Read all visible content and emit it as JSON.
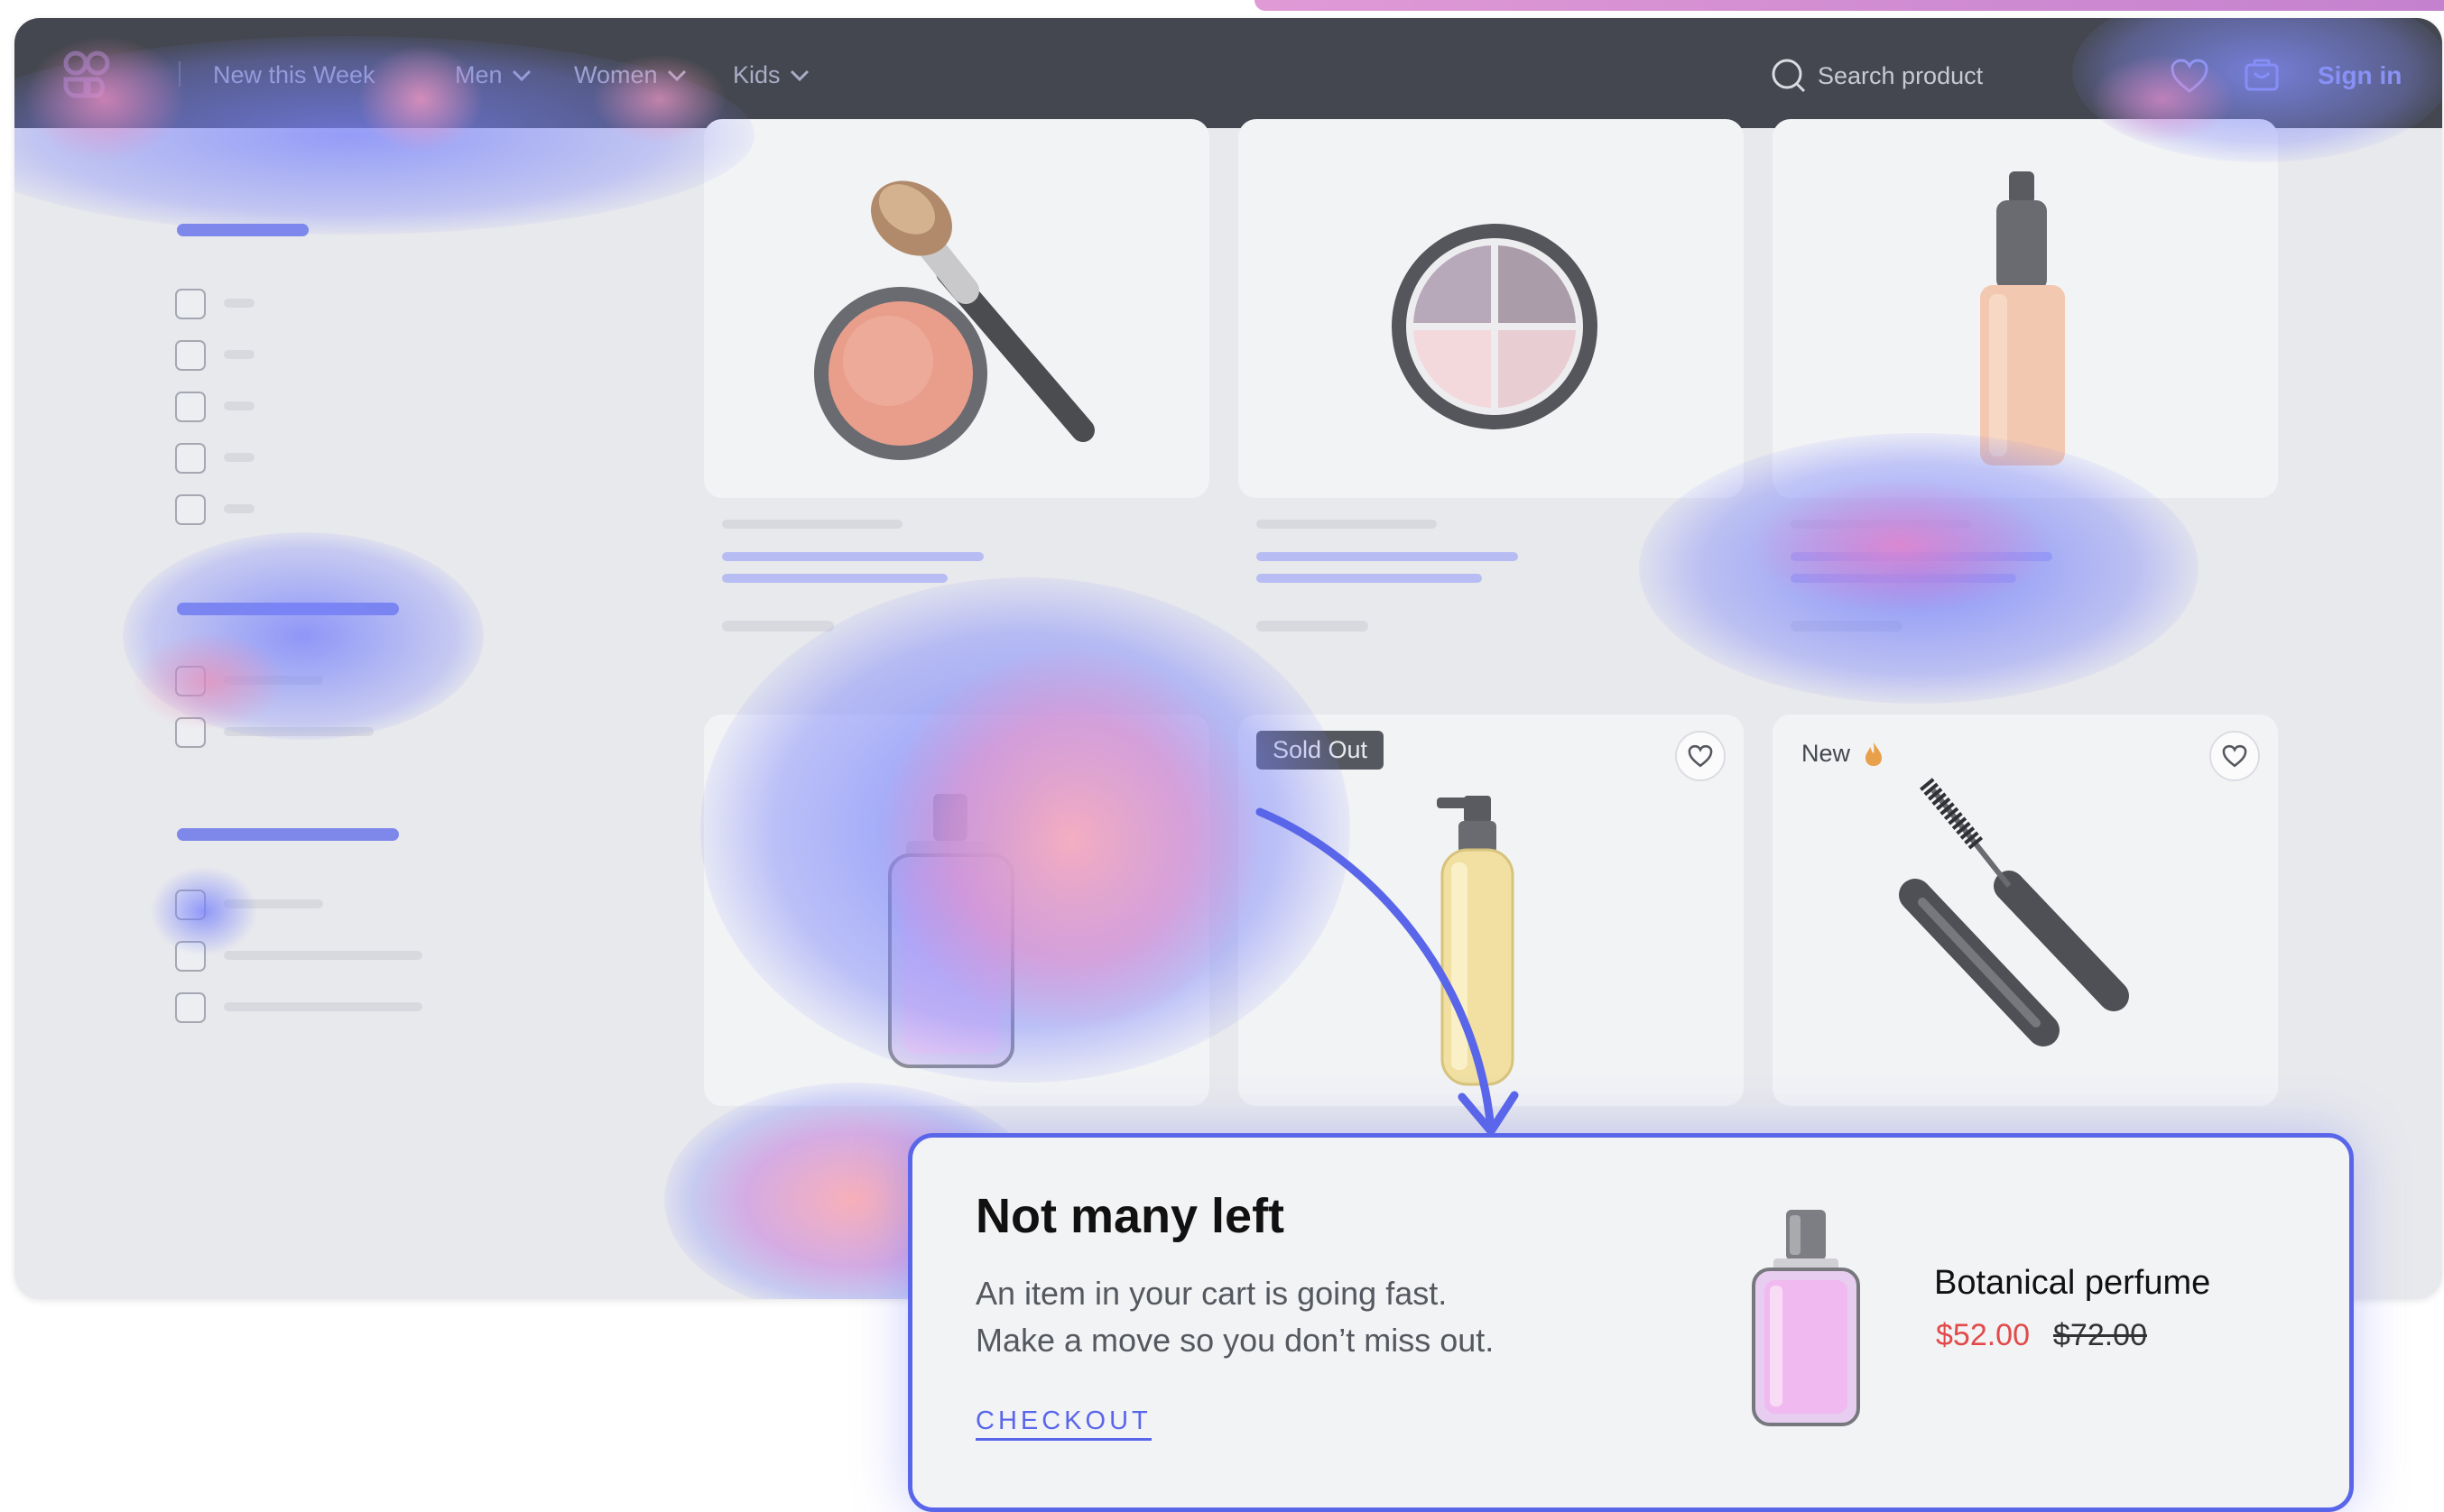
{
  "nav": {
    "items": [
      {
        "label": "New this Week"
      },
      {
        "label": "Men"
      },
      {
        "label": "Women"
      },
      {
        "label": "Kids"
      }
    ],
    "search_placeholder": "Search product",
    "signin_label": "Sign in"
  },
  "products": {
    "badges": {
      "sold_out": "Sold Out",
      "new": "New"
    }
  },
  "popup": {
    "title": "Not many left",
    "line1": "An item in your cart is going fast.",
    "line2": "Make a move so you don’t miss out.",
    "cta": "CHECKOUT",
    "product_name": "Botanical perfume",
    "price_sale": "$52.00",
    "price_original": "$72.00"
  },
  "colors": {
    "accent": "#5a66ea",
    "sale": "#e24a4a",
    "navbar": "#44474f"
  },
  "icons": [
    "logo-icon",
    "chevron-down-icon",
    "search-icon",
    "heart-icon",
    "cart-icon",
    "fire-icon"
  ]
}
